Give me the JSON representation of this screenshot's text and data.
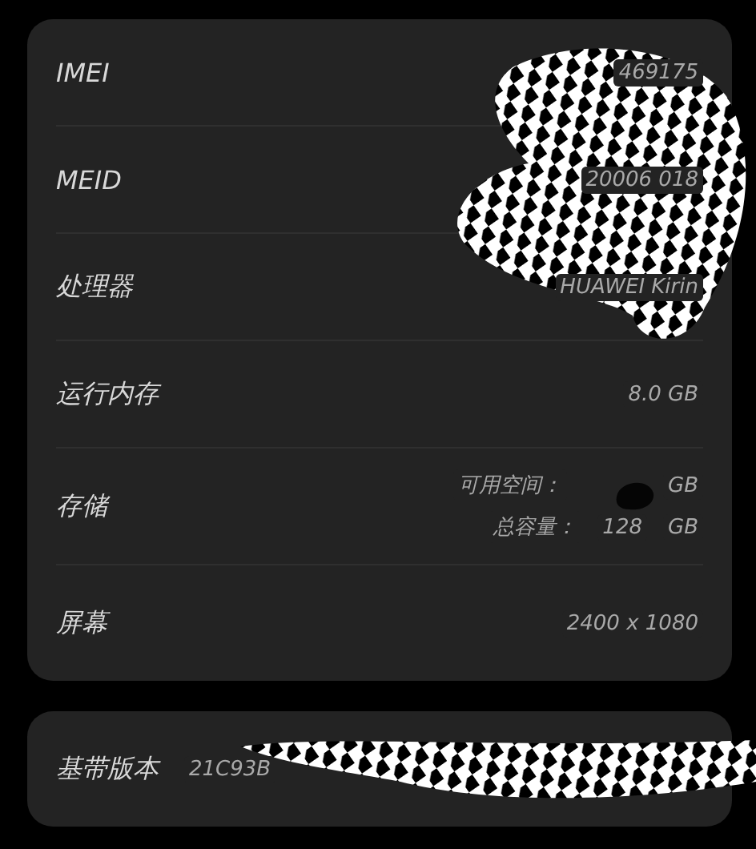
{
  "cards": [
    {
      "rows": [
        {
          "kind": "single",
          "label": "IMEI",
          "value": "469175"
        },
        {
          "kind": "single",
          "label": "MEID",
          "value": "20006 018"
        },
        {
          "kind": "single",
          "label": "处理器",
          "value": "HUAWEI Kirin"
        },
        {
          "kind": "single",
          "label": "运行内存",
          "value": "8.0 GB"
        },
        {
          "kind": "multi",
          "label": "存储",
          "lines": [
            {
              "label": "可用空间：",
              "unit": "GB"
            },
            {
              "label": "总容量：",
              "amount": "128",
              "unit": "GB"
            }
          ]
        },
        {
          "kind": "single",
          "label": "屏幕",
          "value": "2400 x 1080"
        }
      ]
    },
    {
      "rows": [
        {
          "kind": "inline",
          "label": "基带版本",
          "value": "21C93B"
        }
      ]
    }
  ]
}
